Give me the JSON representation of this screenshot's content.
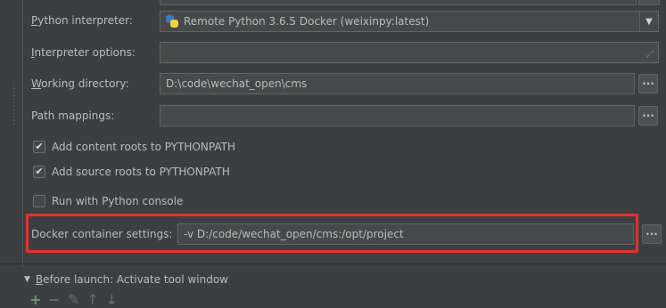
{
  "form": {
    "python_interpreter": {
      "label": "Python interpreter:",
      "mnemonic": "P",
      "label_rest": "ython interpreter:",
      "value": "Remote Python 3.6.5 Docker (weixinpy:latest)"
    },
    "interpreter_options": {
      "label": "Interpreter options:",
      "mnemonic": "I",
      "label_rest": "nterpreter options:",
      "value": ""
    },
    "working_directory": {
      "label": "Working directory:",
      "mnemonic": "W",
      "label_rest": "orking directory:",
      "value": "D:\\code\\wechat_open\\cms",
      "browse_label": "..."
    },
    "path_mappings": {
      "label": "Path mappings:",
      "value": "",
      "browse_label": "..."
    },
    "checkboxes": [
      {
        "label": "Add content roots to PYTHONPATH",
        "checked": true
      },
      {
        "label": "Add source roots to PYTHONPATH",
        "checked": true
      },
      {
        "label": "Run with Python console",
        "checked": false
      }
    ],
    "docker_container_settings": {
      "label": "Docker container settings:",
      "value": "-v D:/code/wechat_open/cms:/opt/project",
      "browse_label": "..."
    }
  },
  "before_launch": {
    "label": "Before launch: Activate tool window",
    "mnemonic": "B",
    "label_rest": "efore launch: Activate tool window"
  },
  "toolbar": {
    "add": "+",
    "remove": "−",
    "edit": "✎",
    "move_up": "↑",
    "move_down": "↓"
  },
  "colors": {
    "background": "#3c3f41",
    "field_background": "#45494a",
    "text": "#bbbbbb",
    "highlight_border": "#e2312f",
    "add_icon": "#5fa35b"
  },
  "icons": {
    "interpreter": "python-logo-icon",
    "dropdown": "chevron-down-icon",
    "expand": "expand-arrows-icon",
    "before_launch_toggle": "triangle-down-icon"
  }
}
